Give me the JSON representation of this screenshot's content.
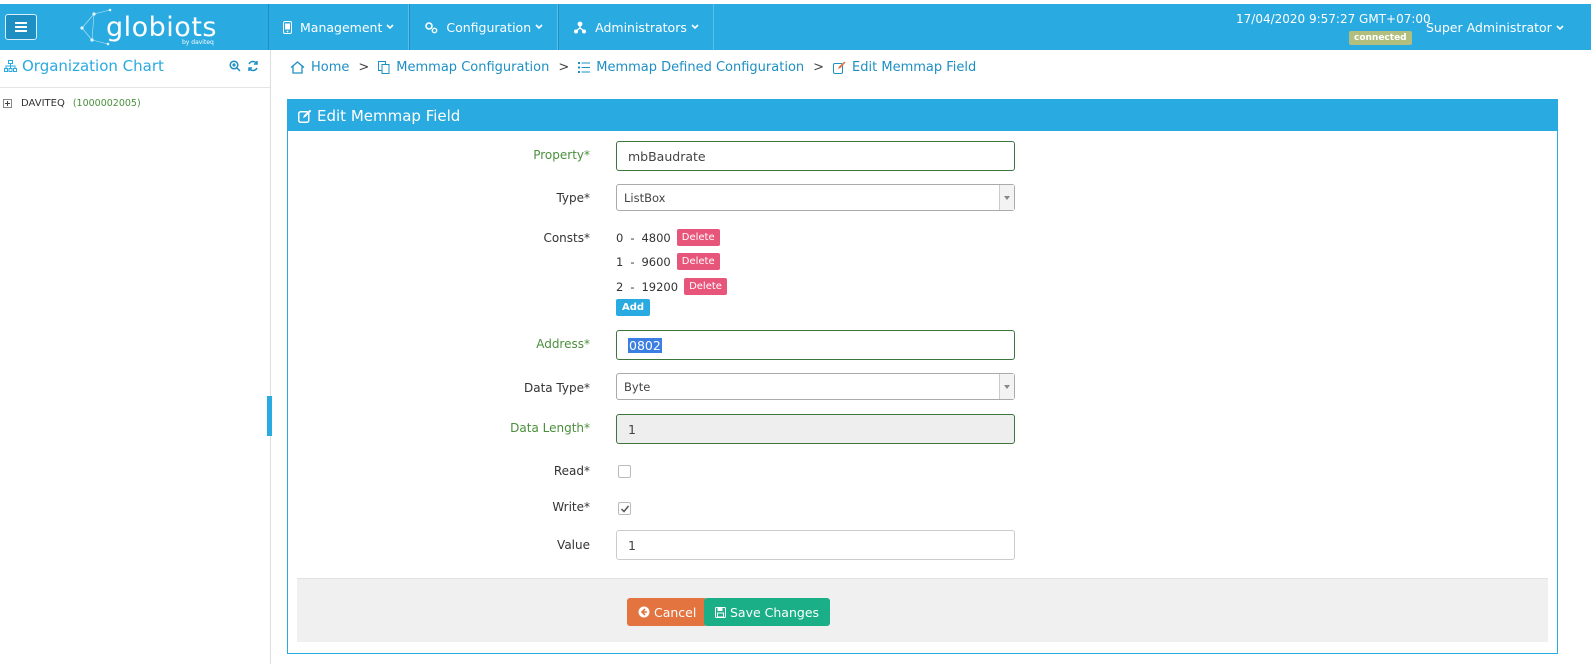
{
  "app": {
    "logo_text": "globiots",
    "logo_sub": "by daviteq"
  },
  "topnav": {
    "items": [
      {
        "label": "Management",
        "icon": "phone-device-icon"
      },
      {
        "label": "Configuration",
        "icon": "gears-icon"
      },
      {
        "label": "Administrators",
        "icon": "sitemap-icon"
      }
    ],
    "datetime": "17/04/2020 9:57:27 GMT+07:00",
    "connection_status": "connected",
    "user": "Super Administrator"
  },
  "sidebar": {
    "title": "Organization Chart",
    "tree": [
      {
        "label": "DAVITEQ",
        "code": "(1000002005)"
      }
    ]
  },
  "breadcrumb": [
    {
      "label": "Home",
      "icon": "home-icon"
    },
    {
      "label": "Memmap Configuration",
      "icon": "copy-icon"
    },
    {
      "label": "Memmap Defined Configuration",
      "icon": "list-icon"
    },
    {
      "label": "Edit Memmap Field",
      "icon": "edit-icon"
    }
  ],
  "form": {
    "title": "Edit Memmap Field",
    "property": {
      "label": "Property*",
      "value": "mbBaudrate"
    },
    "type": {
      "label": "Type*",
      "value": "ListBox"
    },
    "consts": {
      "label": "Consts*",
      "items": [
        {
          "key": "0",
          "value": "4800"
        },
        {
          "key": "1",
          "value": "9600"
        },
        {
          "key": "2",
          "value": "19200"
        }
      ],
      "delete_label": "Delete",
      "add_label": "Add"
    },
    "address": {
      "label": "Address*",
      "value": "0802"
    },
    "data_type": {
      "label": "Data Type*",
      "value": "Byte"
    },
    "data_length": {
      "label": "Data Length*",
      "value": "1"
    },
    "read": {
      "label": "Read*",
      "checked": false
    },
    "write": {
      "label": "Write*",
      "checked": true
    },
    "value": {
      "label": "Value",
      "value": "1"
    },
    "cancel_label": "Cancel",
    "save_label": "Save Changes"
  },
  "colors": {
    "primary": "#29aae1",
    "valid_green": "#4a8f3c",
    "delete": "#e8557a",
    "cancel": "#e3733f",
    "save": "#1aaf87",
    "connected_badge": "#b2be7e"
  }
}
